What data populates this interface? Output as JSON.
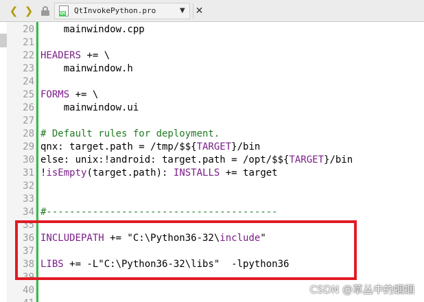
{
  "toolbar": {
    "back_label": "❮",
    "forward_label": "❯",
    "file_name": "QtInvokePython.pro",
    "dropdown_glyph": "▼",
    "close_glyph": "✕",
    "file_badge": "Qt"
  },
  "lines": [
    {
      "num": "20",
      "parts": [
        {
          "t": "    mainwindow.cpp",
          "c": "plain"
        }
      ]
    },
    {
      "num": "21",
      "parts": []
    },
    {
      "num": "22",
      "parts": [
        {
          "t": "HEADERS",
          "c": "kw"
        },
        {
          "t": " += \\",
          "c": "plain"
        }
      ]
    },
    {
      "num": "23",
      "parts": [
        {
          "t": "    mainwindow.h",
          "c": "plain"
        }
      ]
    },
    {
      "num": "24",
      "parts": []
    },
    {
      "num": "25",
      "parts": [
        {
          "t": "FORMS",
          "c": "kw"
        },
        {
          "t": " += \\",
          "c": "plain"
        }
      ]
    },
    {
      "num": "26",
      "parts": [
        {
          "t": "    mainwindow.ui",
          "c": "plain"
        }
      ]
    },
    {
      "num": "27",
      "parts": []
    },
    {
      "num": "28",
      "parts": [
        {
          "t": "# Default rules for deployment.",
          "c": "cmt"
        }
      ]
    },
    {
      "num": "29",
      "parts": [
        {
          "t": "qnx: target.path = /tmp/$${",
          "c": "plain"
        },
        {
          "t": "TARGET",
          "c": "var"
        },
        {
          "t": "}/bin",
          "c": "plain"
        }
      ]
    },
    {
      "num": "30",
      "parts": [
        {
          "t": "else: unix:!android: target.path = /opt/$${",
          "c": "plain"
        },
        {
          "t": "TARGET",
          "c": "var"
        },
        {
          "t": "}/bin",
          "c": "plain"
        }
      ]
    },
    {
      "num": "31",
      "parts": [
        {
          "t": "!",
          "c": "plain"
        },
        {
          "t": "isEmpty",
          "c": "kw"
        },
        {
          "t": "(target.path): ",
          "c": "plain"
        },
        {
          "t": "INSTALLS",
          "c": "kw"
        },
        {
          "t": " += target",
          "c": "plain"
        }
      ]
    },
    {
      "num": "32",
      "parts": []
    },
    {
      "num": "33",
      "parts": []
    },
    {
      "num": "34",
      "parts": [
        {
          "t": "#----------------------------------------",
          "c": "cmt"
        }
      ]
    },
    {
      "num": "35",
      "parts": []
    },
    {
      "num": "36",
      "parts": [
        {
          "t": "INCLUDEPATH",
          "c": "kw"
        },
        {
          "t": " += \"C:\\Python36-32\\",
          "c": "plain"
        },
        {
          "t": "include",
          "c": "kw"
        },
        {
          "t": "\"",
          "c": "plain"
        }
      ]
    },
    {
      "num": "37",
      "parts": []
    },
    {
      "num": "38",
      "parts": [
        {
          "t": "LIBS",
          "c": "kw"
        },
        {
          "t": " += -L\"C:\\Python36-32\\libs\"  -lpython36",
          "c": "plain"
        }
      ]
    },
    {
      "num": "39",
      "parts": []
    },
    {
      "num": "40",
      "parts": []
    },
    {
      "num": "41",
      "parts": []
    }
  ],
  "watermark": "CSDN @草丛中的蝈蝈",
  "colors": {
    "keyword": "#7a1d87",
    "comment": "#237a23",
    "highlight_border": "#e01b24",
    "change_bar": "#2fbf4a",
    "nav_arrows": "#b49a00"
  }
}
